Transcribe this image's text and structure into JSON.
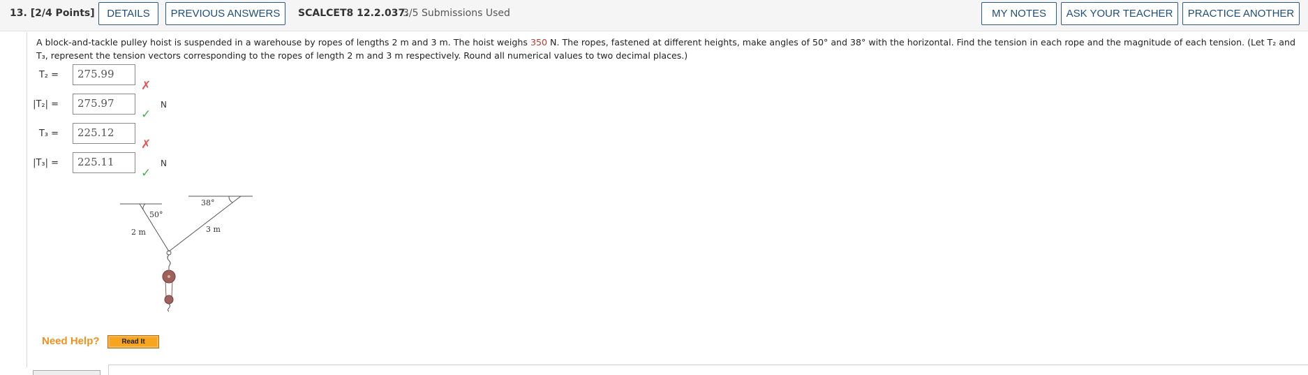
{
  "header": {
    "question_number": "13.",
    "points": "[2/4 Points]",
    "details_label": "DETAILS",
    "previous_answers_label": "PREVIOUS ANSWERS",
    "code": "SCALCET8 12.2.037.",
    "submissions": "3/5 Submissions Used",
    "my_notes_label": "MY NOTES",
    "ask_teacher_label": "ASK YOUR TEACHER",
    "practice_another_label": "PRACTICE ANOTHER"
  },
  "question": {
    "text_before": "A block-and-tackle pulley hoist is suspended in a warehouse by ropes of lengths 2 m and 3 m. The hoist weighs ",
    "weight": "350",
    "text_after": " N. The ropes, fastened at different heights, make angles of 50° and 38° with the horizontal. Find the tension in each rope and the magnitude of each tension. (Let T₂ and T₃, represent the tension vectors corresponding to the ropes of length 2 m and 3 m respectively. Round all numerical values to two decimal places.)"
  },
  "answers": [
    {
      "label": "T₂ =",
      "value": "275.99",
      "status": "incorrect",
      "unit": ""
    },
    {
      "label": "|T₂| =",
      "value": "275.97",
      "status": "correct",
      "unit": "N"
    },
    {
      "label": "T₃ =",
      "value": "225.12",
      "status": "incorrect",
      "unit": ""
    },
    {
      "label": "|T₃| =",
      "value": "225.11",
      "status": "correct",
      "unit": "N"
    }
  ],
  "diagram": {
    "angle_left": "50°",
    "angle_right": "38°",
    "rope_left": "2 m",
    "rope_right": "3 m"
  },
  "help": {
    "need_help": "Need Help?",
    "read_it": "Read It"
  },
  "icons": {
    "incorrect": "x-mark-icon",
    "correct": "check-mark-icon"
  },
  "colors": {
    "button_border": "#2c5a86",
    "incorrect": "#e05555",
    "correct": "#4caf50",
    "weight_value": "#c0392b",
    "need_help": "#f0901e"
  }
}
